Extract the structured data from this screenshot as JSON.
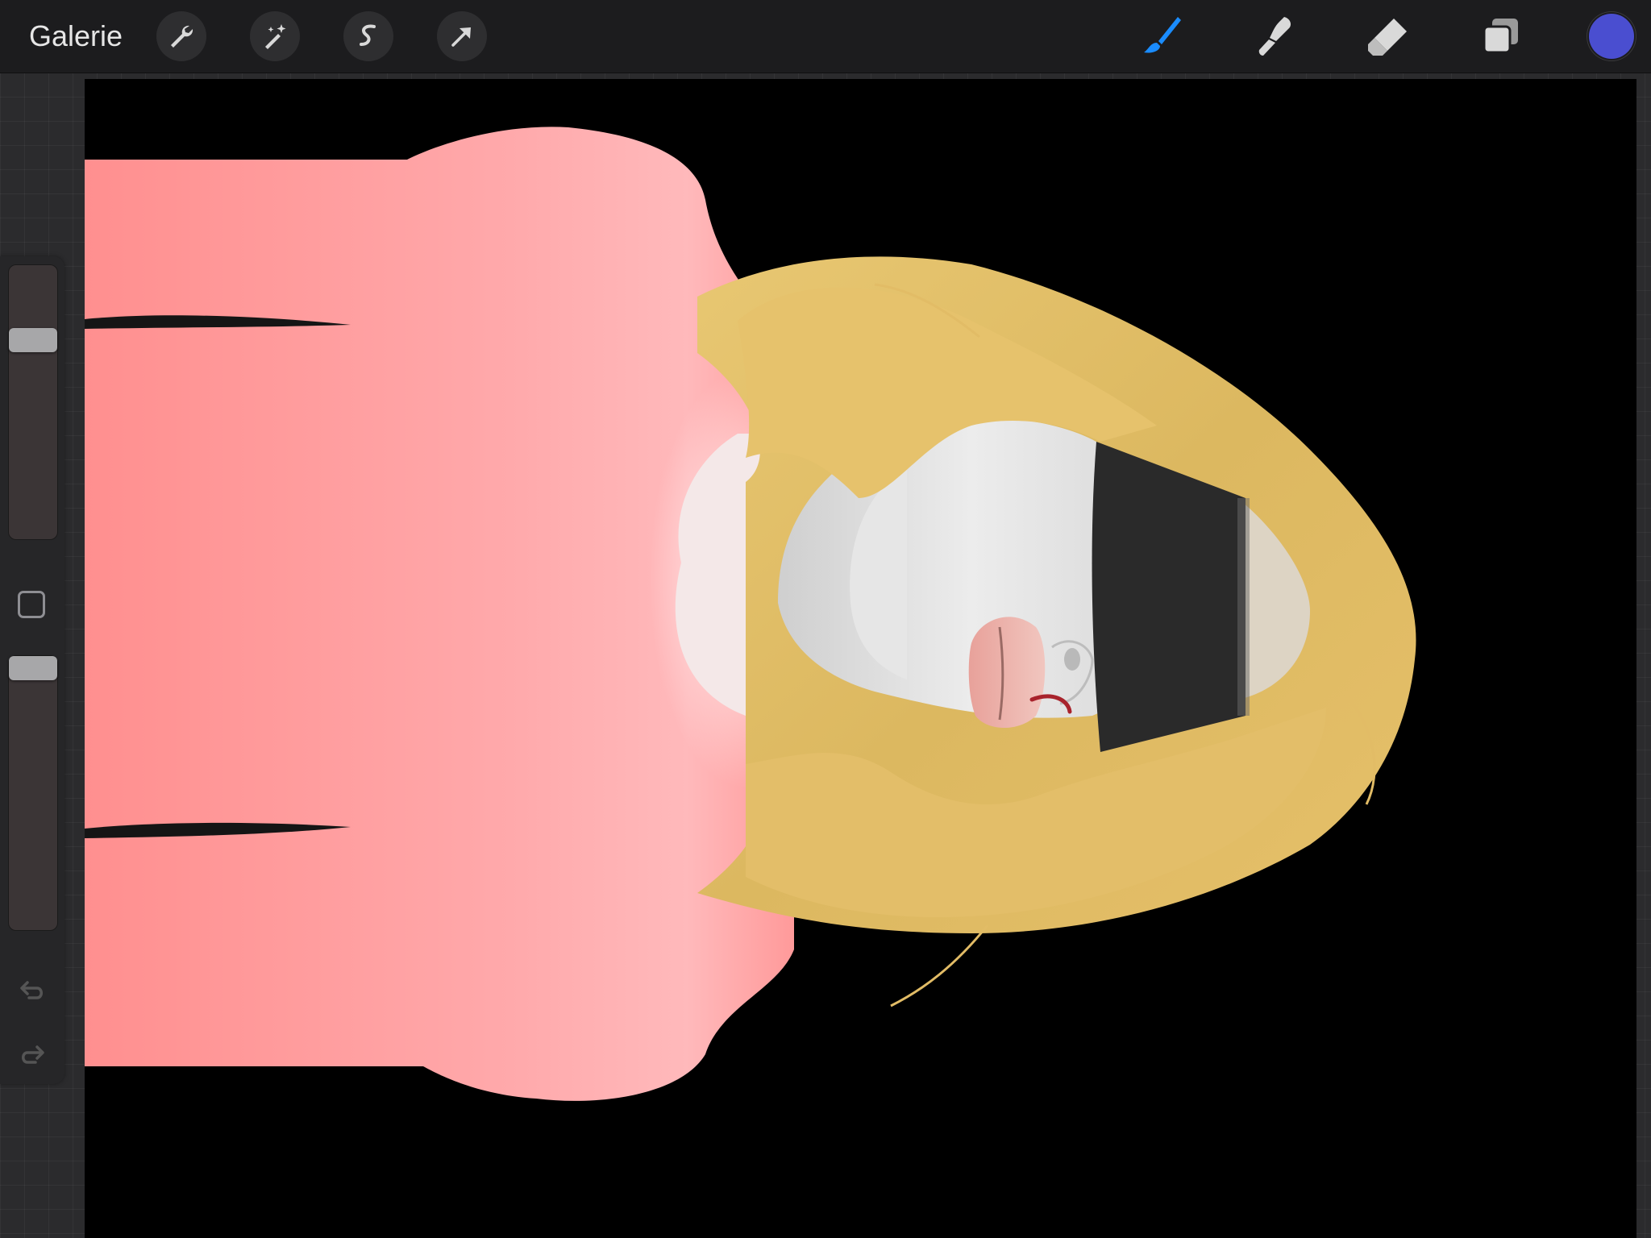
{
  "topbar": {
    "gallery_label": "Galerie",
    "adjustments": [
      "wrench-icon",
      "magic-wand-icon",
      "selection-icon",
      "transform-arrow-icon"
    ],
    "tools": [
      "brush-icon",
      "smudge-icon",
      "eraser-icon",
      "layers-icon"
    ],
    "active_tool": "brush",
    "current_color": "#4a4ed0",
    "active_tool_color": "#1a8cff"
  },
  "sidebar": {
    "brush_size": 0.25,
    "brush_opacity": 1.0,
    "buttons": [
      "modify-button",
      "undo-icon",
      "redo-icon"
    ]
  },
  "canvas": {
    "artwork": "portrait-painting",
    "colors": {
      "background": "#000000",
      "shirt": "#ff9a9a",
      "hair": "#e2bc66",
      "skin": "#e4e4e4",
      "blindfold": "#2a2a2a"
    }
  }
}
